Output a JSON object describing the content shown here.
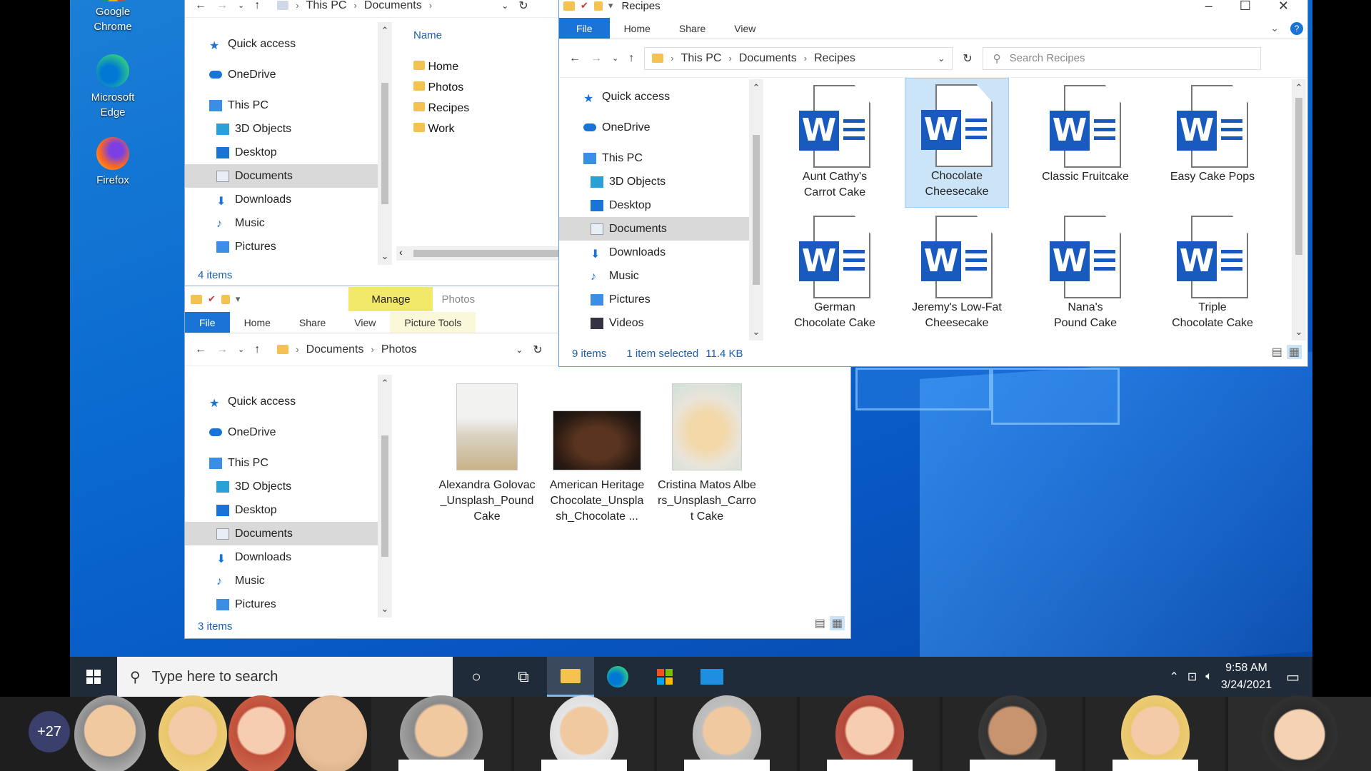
{
  "desktop": {
    "icons": [
      {
        "label": "Google Chrome",
        "color": "#e0a020"
      },
      {
        "label": "Microsoft Edge",
        "color": "#20a080"
      },
      {
        "label": "Firefox",
        "color": "#ff6a1a"
      }
    ]
  },
  "win_docs": {
    "breadcrumb": [
      "This PC",
      "Documents"
    ],
    "column_header": "Name",
    "nav": [
      "Quick access",
      "OneDrive",
      "This PC",
      "3D Objects",
      "Desktop",
      "Documents",
      "Downloads",
      "Music",
      "Pictures"
    ],
    "files": [
      "Home",
      "Photos",
      "Recipes",
      "Work"
    ],
    "status": "4 items"
  },
  "win_recipes": {
    "title": "Recipes",
    "tabs": [
      "File",
      "Home",
      "Share",
      "View"
    ],
    "breadcrumb": [
      "This PC",
      "Documents",
      "Recipes"
    ],
    "search_placeholder": "Search Recipes",
    "nav": [
      "Quick access",
      "OneDrive",
      "This PC",
      "3D Objects",
      "Desktop",
      "Documents",
      "Downloads",
      "Music",
      "Pictures",
      "Videos"
    ],
    "files": [
      {
        "name": "Aunt Cathy's Carrot Cake",
        "selected": false
      },
      {
        "name": "Chocolate Cheesecake",
        "selected": true
      },
      {
        "name": "Classic Fruitcake",
        "selected": false
      },
      {
        "name": "Easy Cake Pops",
        "selected": false
      },
      {
        "name": "German Chocolate Cake",
        "selected": false
      },
      {
        "name": "Jeremy's Low-Fat Cheesecake",
        "selected": false
      },
      {
        "name": "Nana's Pound Cake",
        "selected": false
      },
      {
        "name": "Triple Chocolate Cake",
        "selected": false
      }
    ],
    "status_count": "9 items",
    "status_selected": "1 item selected",
    "status_size": "11.4 KB"
  },
  "win_photos": {
    "manage_label": "Manage",
    "title": "Photos",
    "tabs": [
      "File",
      "Home",
      "Share",
      "View",
      "Picture Tools"
    ],
    "breadcrumb": [
      "Documents",
      "Photos"
    ],
    "nav": [
      "Quick access",
      "OneDrive",
      "This PC",
      "3D Objects",
      "Desktop",
      "Documents",
      "Downloads",
      "Music",
      "Pictures"
    ],
    "files": [
      "Alexandra Golovac_Unsplash_Pound Cake",
      "American Heritage Chocolate_Unsplash_Chocolate ...",
      "Cristina Matos Albers_Unsplash_Carrot Cake"
    ],
    "status": "3 items"
  },
  "taskbar": {
    "search_placeholder": "Type here to search",
    "time": "9:58 AM",
    "date": "3/24/2021"
  },
  "meeting": {
    "extra_participants": "+27",
    "tile_count": 11
  }
}
